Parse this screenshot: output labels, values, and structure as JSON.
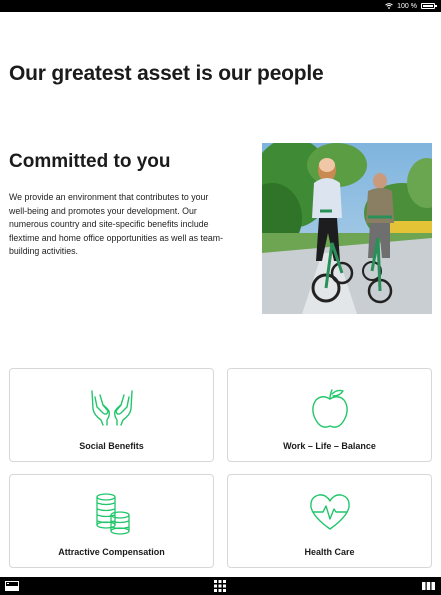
{
  "status": {
    "battery_text": "100 %"
  },
  "page": {
    "title": "Our greatest asset is our people"
  },
  "section": {
    "title": "Committed to you",
    "body": "We provide an environment that contributes to your well-being and promotes your development. Our numerous country and site-specific benefits include flextime and home office opportunities as well as team-building activities."
  },
  "cards": [
    {
      "label": "Social Benefits",
      "icon": "open-hands-icon"
    },
    {
      "label": "Work – Life – Balance",
      "icon": "apple-icon"
    },
    {
      "label": "Attractive Compensation",
      "icon": "coin-stacks-icon"
    },
    {
      "label": "Health Care",
      "icon": "heart-pulse-icon"
    }
  ],
  "colors": {
    "accent": "#22c66b",
    "text": "#1b1b1b",
    "card_border": "#d7d7d7"
  }
}
